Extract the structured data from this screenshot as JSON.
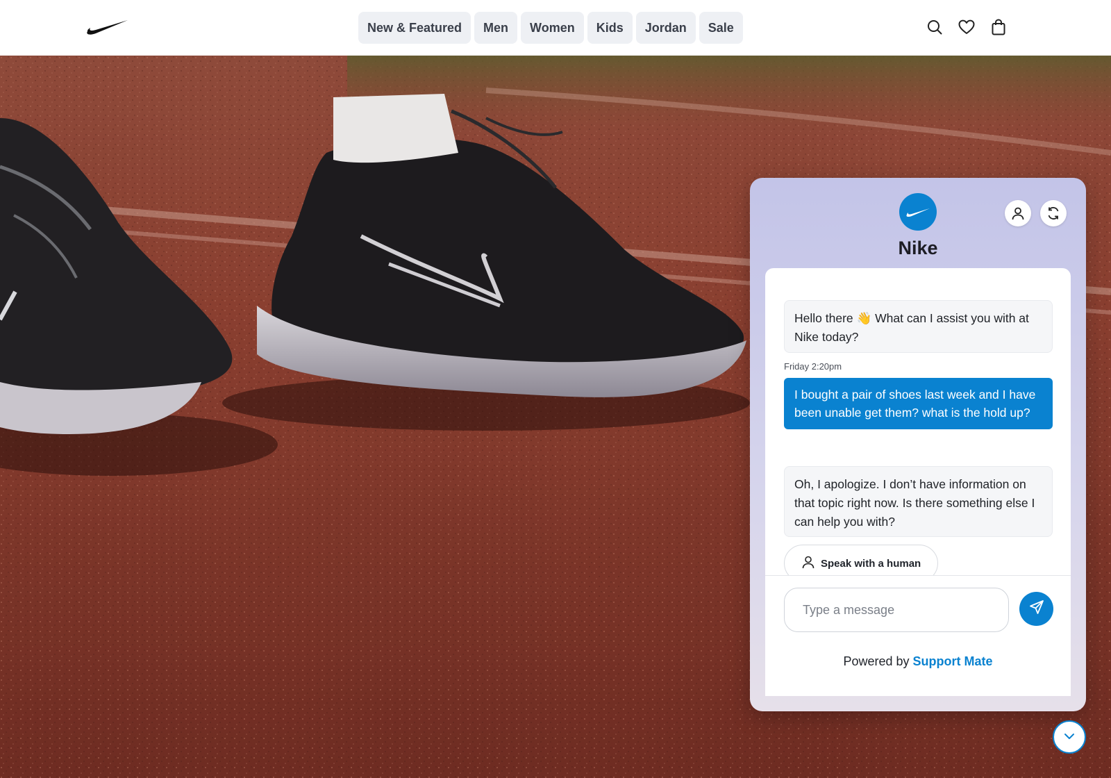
{
  "brand": {
    "name": "Nike",
    "logo_icon": "swoosh-icon",
    "accent": "#0a82d0"
  },
  "nav": {
    "items": [
      {
        "label": "New & Featured"
      },
      {
        "label": "Men"
      },
      {
        "label": "Women"
      },
      {
        "label": "Kids"
      },
      {
        "label": "Jordan"
      },
      {
        "label": "Sale"
      }
    ]
  },
  "header_icons": [
    "search-icon",
    "heart-icon",
    "bag-icon"
  ],
  "chat": {
    "title": "Nike",
    "messages": [
      {
        "from": "bot",
        "text": "Hello there 👋 What can I assist you with at Nike today?"
      },
      {
        "from": "user",
        "time": "Friday 2:20pm",
        "text": "I bought a pair of shoes last week and I have been unable get them? what is the hold up?"
      },
      {
        "from": "bot",
        "text": " Oh, I apologize. I don’t have information on that topic right now. Is there something else I can help you with?"
      }
    ],
    "speak_human_label": "Speak with a human",
    "input": {
      "placeholder": "Type a message",
      "value": ""
    },
    "powered_prefix": "Powered by",
    "powered_link": "Support Mate"
  }
}
